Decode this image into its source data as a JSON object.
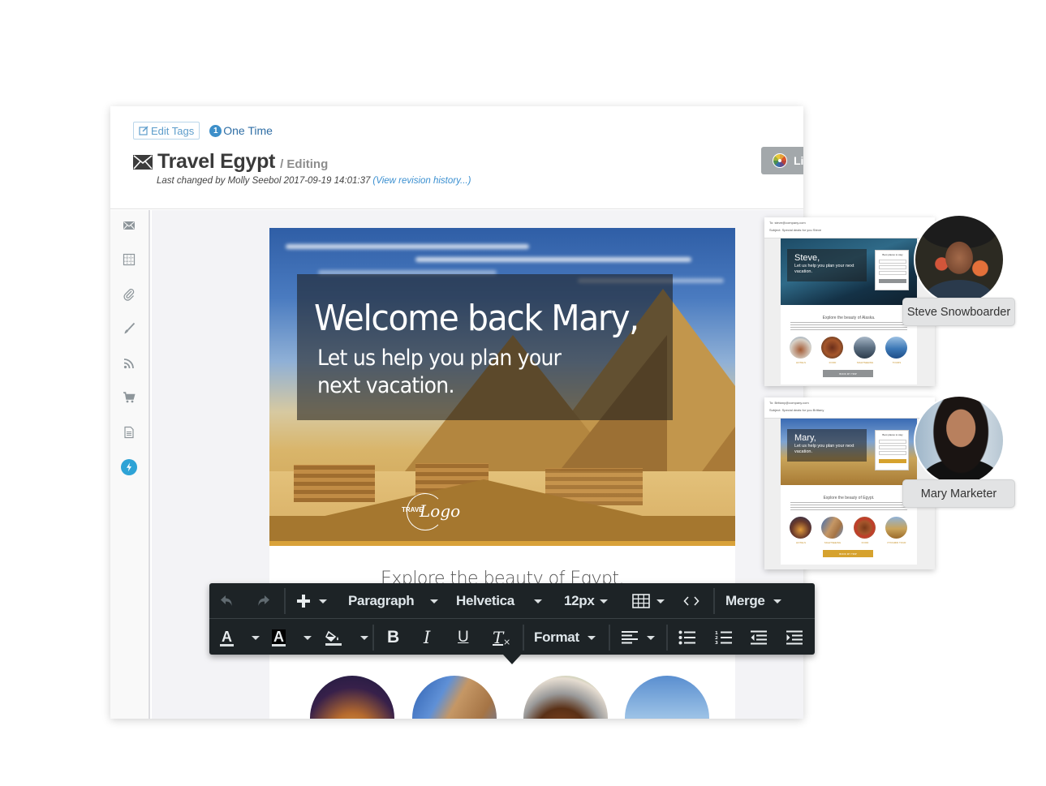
{
  "header": {
    "edit_tags_label": "Edit Tags",
    "one_time_badge": "1",
    "one_time_label": "One Time",
    "title": "Travel Egypt",
    "mode": "/ Editing",
    "last_changed": "Last changed by Molly Seebol 2017-09-19 14:01:37",
    "revision_link": "(View revision history...)",
    "launch_button_label": "Li"
  },
  "sidebar": {
    "items": [
      {
        "icon": "envelope-icon"
      },
      {
        "icon": "table-icon"
      },
      {
        "icon": "paperclip-icon"
      },
      {
        "icon": "brush-icon"
      },
      {
        "icon": "rss-icon"
      },
      {
        "icon": "cart-icon"
      },
      {
        "icon": "document-icon"
      },
      {
        "icon": "lightning-icon",
        "active": true
      }
    ],
    "active_color": "#2ea3d6"
  },
  "email": {
    "hero_heading": "Welcome back Mary,",
    "hero_subtext": "Let us help you plan your next vacation.",
    "logo_text_left": "TRAVE",
    "logo_text_script": "Logo",
    "explore_heading": "Explore the beauty of Egypt.",
    "accent_color": "#a5772f"
  },
  "toolbar": {
    "row1": {
      "undo": "undo-icon",
      "redo": "redo-icon",
      "insert": "plus-icon",
      "block_format": "Paragraph",
      "font_family": "Helvetica",
      "font_size": "12px",
      "table": "table-icon",
      "source": "code-icon",
      "merge": "Merge"
    },
    "row2": {
      "text_color": "A",
      "bg_color": "A",
      "fill": "paint-bucket-icon",
      "bold": "B",
      "italic": "I",
      "underline": "U",
      "clear_format": "T",
      "format": "Format",
      "align": "align-left-icon",
      "bullet_list": "bullet-list-icon",
      "numbered_list": "numbered-list-icon",
      "outdent": "outdent-icon",
      "indent": "indent-icon"
    }
  },
  "previews": [
    {
      "to": "To: steve@company.com",
      "subject": "Subject: Special deals for you Steve",
      "name": "Steve,",
      "sub": "Let us help you plan your next vacation.",
      "form_title": "Best places to stay",
      "explore": "Explore the beauty of Alaska.",
      "captions": [
        "HOTELS",
        "FOOD",
        "SIGHTSEEING",
        "TOURS"
      ],
      "button": "BOOK MY TRIP",
      "button_color": "#8f9294",
      "persona": "Steve Snowboarder"
    },
    {
      "to": "To: Brittany@company.com",
      "subject": "Subject: Special deals for you Brittany",
      "name": "Mary,",
      "sub": "Let us help you plan your next vacation.",
      "form_title": "Best places to stay",
      "explore": "Explore the beauty of Egypt.",
      "captions": [
        "HOTELS",
        "SIGHTSEEING",
        "FOOD",
        "PYRAMID TOUR"
      ],
      "button": "BOOK MY TRIP",
      "button_color": "#d6a22e",
      "persona": "Mary Marketer"
    }
  ]
}
